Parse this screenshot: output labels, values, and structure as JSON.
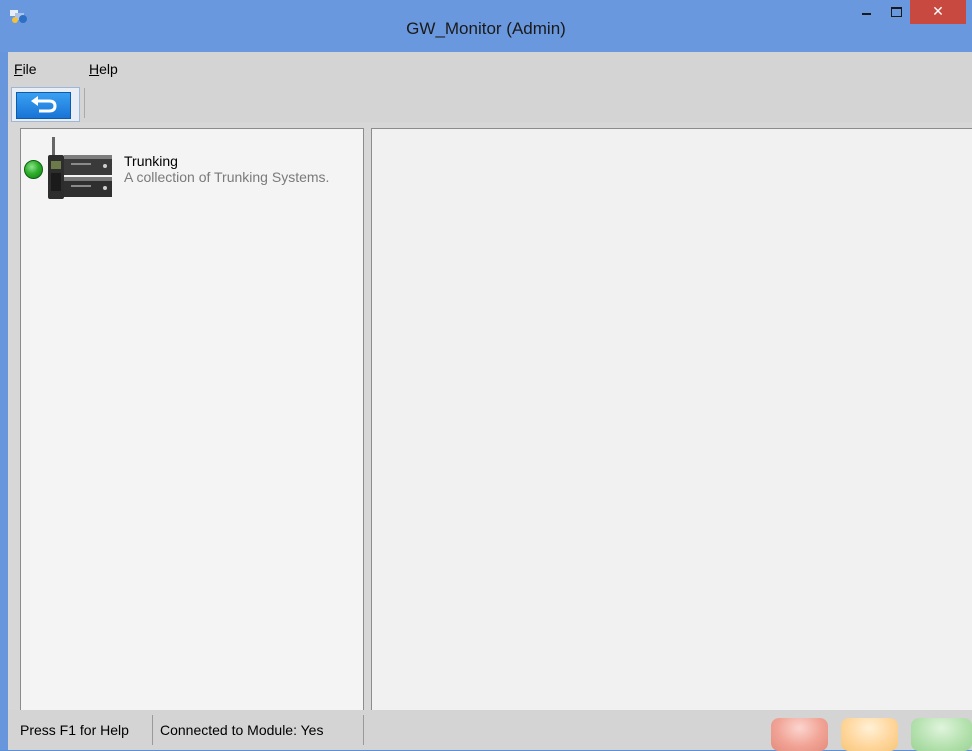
{
  "window": {
    "title": "GW_Monitor (Admin)",
    "app_icon": "app-logo-icon"
  },
  "title_buttons": {
    "minimize_icon": "minimize-icon",
    "maximize_icon": "maximize-icon",
    "close_label": "✕"
  },
  "menu": {
    "file_first": "F",
    "file_rest": "ile",
    "help_first": "H",
    "help_rest": "elp"
  },
  "toolbar": {
    "back_icon": "back-arrow-icon"
  },
  "tree": {
    "items": [
      {
        "title": "Trunking",
        "description": "A collection of Trunking Systems.",
        "status": "online",
        "status_color": "#2fb02c",
        "icon": "trunking-device-icon"
      }
    ]
  },
  "statusbar": {
    "help_text": "Press F1 for Help",
    "connection_text": "Connected to Module: Yes",
    "lights": [
      {
        "name": "red-light",
        "color": "#f1a496"
      },
      {
        "name": "yellow-light",
        "color": "#ffd79e"
      },
      {
        "name": "green-light",
        "color": "#b7e2b1"
      }
    ]
  }
}
